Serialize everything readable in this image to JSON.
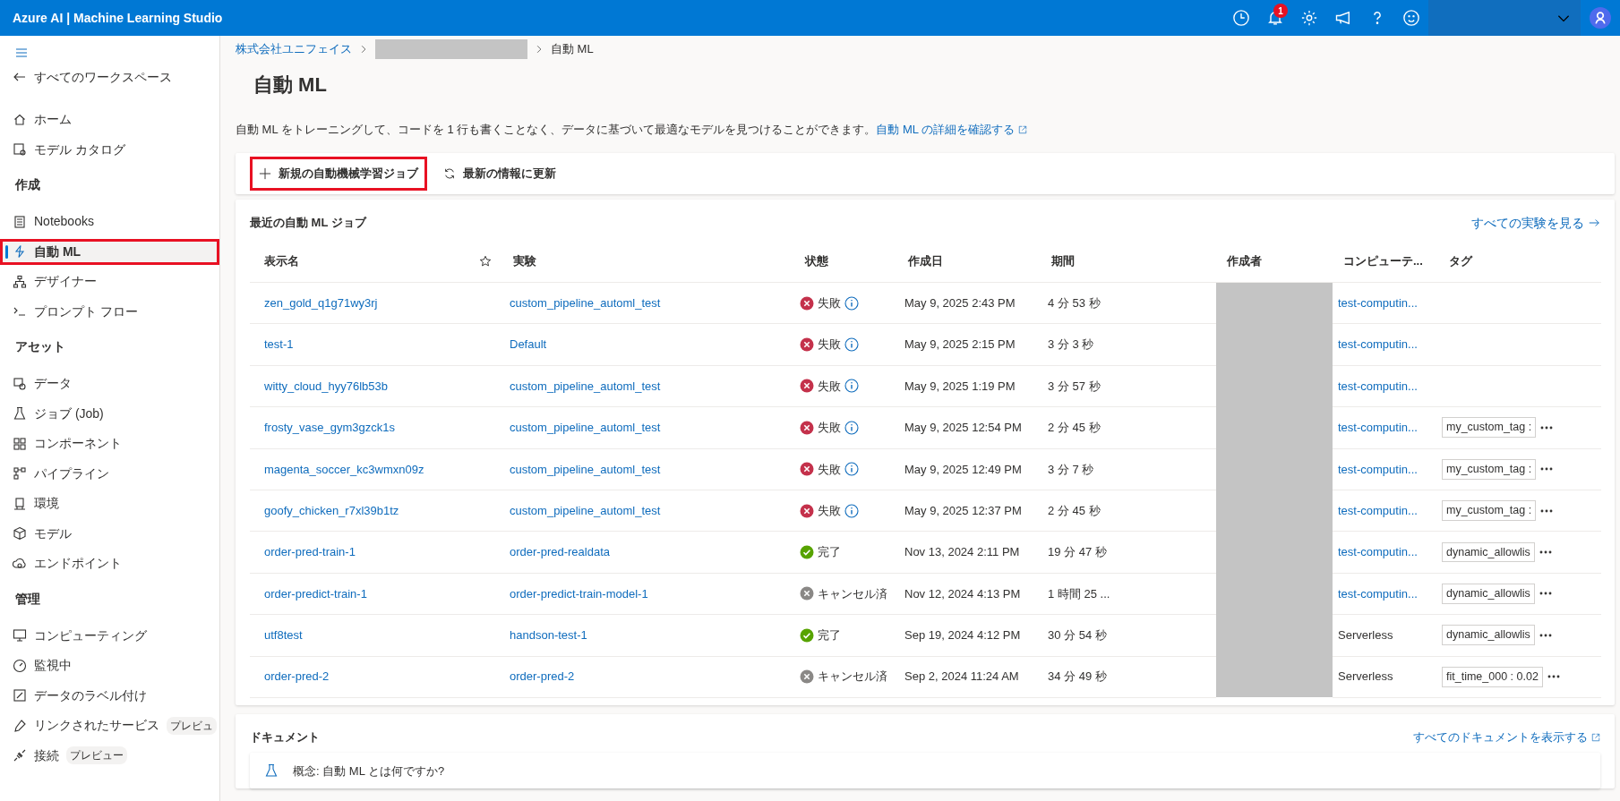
{
  "app_title": "Azure AI | Machine Learning Studio",
  "topbar": {
    "notification_count": "1"
  },
  "sidebar": {
    "items": [
      {
        "kind": "back",
        "label": "すべてのワークスペース",
        "selected": false,
        "highlighted": false
      },
      {
        "kind": "item",
        "label": "ホーム",
        "selected": false,
        "highlighted": false
      },
      {
        "kind": "item",
        "label": "モデル カタログ",
        "selected": false,
        "highlighted": false
      },
      {
        "kind": "header",
        "label": "作成"
      },
      {
        "kind": "item",
        "label": "Notebooks",
        "selected": false,
        "highlighted": false
      },
      {
        "kind": "item",
        "label": "自動 ML",
        "selected": true,
        "highlighted": true
      },
      {
        "kind": "item",
        "label": "デザイナー",
        "selected": false,
        "highlighted": false
      },
      {
        "kind": "item",
        "label": "プロンプト フロー",
        "selected": false,
        "highlighted": false
      },
      {
        "kind": "header",
        "label": "アセット"
      },
      {
        "kind": "item",
        "label": "データ",
        "selected": false,
        "highlighted": false
      },
      {
        "kind": "item",
        "label": "ジョブ (Job)",
        "selected": false,
        "highlighted": false
      },
      {
        "kind": "item",
        "label": "コンポーネント",
        "selected": false,
        "highlighted": false
      },
      {
        "kind": "item",
        "label": "パイプライン",
        "selected": false,
        "highlighted": false
      },
      {
        "kind": "item",
        "label": "環境",
        "selected": false,
        "highlighted": false
      },
      {
        "kind": "item",
        "label": "モデル",
        "selected": false,
        "highlighted": false
      },
      {
        "kind": "item",
        "label": "エンドポイント",
        "selected": false,
        "highlighted": false
      },
      {
        "kind": "header",
        "label": "管理"
      },
      {
        "kind": "item",
        "label": "コンピューティング",
        "selected": false,
        "highlighted": false
      },
      {
        "kind": "item",
        "label": "監視中",
        "selected": false,
        "highlighted": false
      },
      {
        "kind": "item",
        "label": "データのラベル付け",
        "selected": false,
        "highlighted": false
      },
      {
        "kind": "item",
        "label": "リンクされたサービス",
        "badge": "プレビュ",
        "selected": false,
        "highlighted": false
      },
      {
        "kind": "item",
        "label": "接続",
        "badge": "プレビュー",
        "selected": false,
        "highlighted": false
      }
    ]
  },
  "breadcrumb": [
    {
      "kind": "link",
      "label": "株式会社ユニフェイス"
    },
    {
      "kind": "redacted"
    },
    {
      "kind": "current",
      "label": "自動 ML"
    }
  ],
  "page_title": "自動 ML",
  "description": {
    "text": "自動 ML をトレーニングして、コードを 1 行も書くことなく、データに基づいて最適なモデルを見つけることができます。",
    "link": "自動 ML の詳細を確認する"
  },
  "toolbar": [
    {
      "kind": "add",
      "label": "新規の自動機械学習ジョブ",
      "highlighted": true
    },
    {
      "kind": "refresh",
      "label": "最新の情報に更新",
      "highlighted": false
    }
  ],
  "jobs": {
    "title": "最近の自動 ML ジョブ",
    "link": "すべての実験を見る",
    "columns": [
      "表示名",
      "",
      "実験",
      "状態",
      "作成日",
      "期間",
      "作成者",
      "コンピューテ...",
      "タグ"
    ],
    "rows": [
      {
        "name": "zen_gold_q1g71wy3rj",
        "experiment": "custom_pipeline_automl_test",
        "status": {
          "kind": "failed",
          "label": "失敗"
        },
        "created": "May 9, 2025 2:43 PM",
        "duration": "4 分 53 秒",
        "compute": {
          "kind": "link",
          "label": "test-computin..."
        }
      },
      {
        "name": "test-1",
        "experiment": "Default",
        "status": {
          "kind": "failed",
          "label": "失敗"
        },
        "created": "May 9, 2025 2:15 PM",
        "duration": "3 分 3 秒",
        "compute": {
          "kind": "link",
          "label": "test-computin..."
        }
      },
      {
        "name": "witty_cloud_hyy76lb53b",
        "experiment": "custom_pipeline_automl_test",
        "status": {
          "kind": "failed",
          "label": "失敗"
        },
        "created": "May 9, 2025 1:19 PM",
        "duration": "3 分 57 秒",
        "compute": {
          "kind": "link",
          "label": "test-computin..."
        }
      },
      {
        "name": "frosty_vase_gym3gzck1s",
        "experiment": "custom_pipeline_automl_test",
        "status": {
          "kind": "failed",
          "label": "失敗"
        },
        "created": "May 9, 2025 12:54 PM",
        "duration": "2 分 45 秒",
        "compute": {
          "kind": "link",
          "label": "test-computin..."
        },
        "tag": "my_custom_tag :"
      },
      {
        "name": "magenta_soccer_kc3wmxn09z",
        "experiment": "custom_pipeline_automl_test",
        "status": {
          "kind": "failed",
          "label": "失敗"
        },
        "created": "May 9, 2025 12:49 PM",
        "duration": "3 分 7 秒",
        "compute": {
          "kind": "link",
          "label": "test-computin..."
        },
        "tag": "my_custom_tag :"
      },
      {
        "name": "goofy_chicken_r7xl39b1tz",
        "experiment": "custom_pipeline_automl_test",
        "status": {
          "kind": "failed",
          "label": "失敗"
        },
        "created": "May 9, 2025 12:37 PM",
        "duration": "2 分 45 秒",
        "compute": {
          "kind": "link",
          "label": "test-computin..."
        },
        "tag": "my_custom_tag :"
      },
      {
        "name": "order-pred-train-1",
        "experiment": "order-pred-realdata",
        "status": {
          "kind": "completed",
          "label": "完了"
        },
        "created": "Nov 13, 2024 2:11 PM",
        "duration": "19 分 47 秒",
        "compute": {
          "kind": "link",
          "label": "test-computin..."
        },
        "tag": "dynamic_allowlis"
      },
      {
        "name": "order-predict-train-1",
        "experiment": "order-predict-train-model-1",
        "status": {
          "kind": "canceled",
          "label": "キャンセル済"
        },
        "created": "Nov 12, 2024 4:13 PM",
        "duration": "1 時間 25 ...",
        "compute": {
          "kind": "link",
          "label": "test-computin..."
        },
        "tag": "dynamic_allowlis"
      },
      {
        "name": "utf8test",
        "experiment": "handson-test-1",
        "status": {
          "kind": "completed",
          "label": "完了"
        },
        "created": "Sep 19, 2024 4:12 PM",
        "duration": "30 分 54 秒",
        "compute": {
          "kind": "text",
          "label": "Serverless"
        },
        "tag": "dynamic_allowlis"
      },
      {
        "name": "order-pred-2",
        "experiment": "order-pred-2",
        "status": {
          "kind": "canceled",
          "label": "キャンセル済"
        },
        "created": "Sep 2, 2024 11:24 AM",
        "duration": "34 分 49 秒",
        "compute": {
          "kind": "text",
          "label": "Serverless"
        },
        "tag": "fit_time_000 : 0.02"
      }
    ]
  },
  "documents": {
    "title": "ドキュメント",
    "link": "すべてのドキュメントを表示する",
    "items": [
      {
        "label": "概念: 自動 ML とは何ですか?"
      }
    ]
  }
}
